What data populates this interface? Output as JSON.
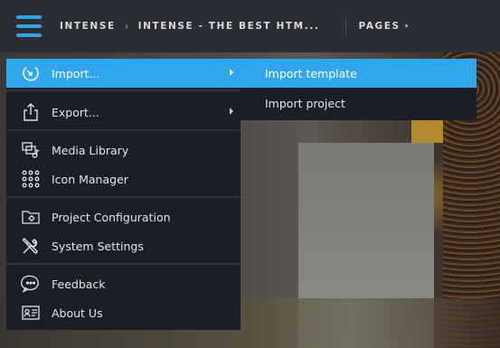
{
  "topbar": {
    "breadcrumb": [
      "INTENSE",
      "INTENSE - THE BEST HTM..."
    ],
    "separator": "›",
    "pages_label": "PAGES",
    "pages_caret": "▾"
  },
  "menu": {
    "items": [
      {
        "label": "Import...",
        "icon": "import-icon",
        "submenu": true
      },
      {
        "label": "Export...",
        "icon": "export-icon",
        "submenu": true
      },
      {
        "label": "Media Library",
        "icon": "media-library-icon"
      },
      {
        "label": "Icon Manager",
        "icon": "icon-manager-grid-icon"
      },
      {
        "label": "Project Configuration",
        "icon": "folder-gear-icon"
      },
      {
        "label": "System Settings",
        "icon": "tools-icon"
      },
      {
        "label": "Feedback",
        "icon": "feedback-icon"
      },
      {
        "label": "About Us",
        "icon": "id-card-icon"
      }
    ]
  },
  "submenu": {
    "items": [
      {
        "label": "Import template"
      },
      {
        "label": "Import project"
      }
    ]
  },
  "colors": {
    "accent": "#2fa6ee",
    "menu_bg": "#1b1e26",
    "topbar_bg": "#2b2d35",
    "hamburger": "#34a3e6"
  }
}
